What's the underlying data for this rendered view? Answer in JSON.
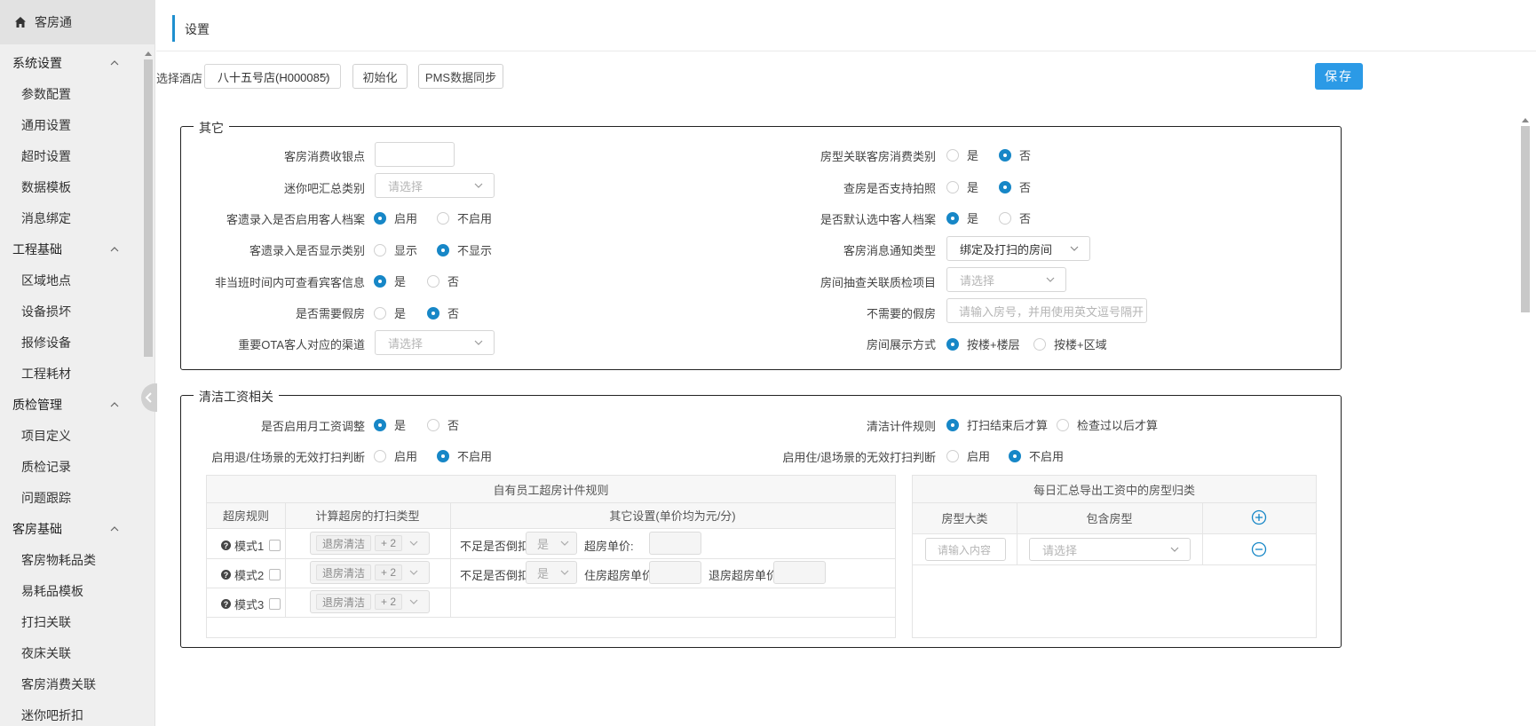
{
  "app": {
    "title": "客房通"
  },
  "sidebar": {
    "groups": [
      {
        "label": "系统设置",
        "items": [
          "参数配置",
          "通用设置",
          "超时设置",
          "数据模板",
          "消息绑定"
        ]
      },
      {
        "label": "工程基础",
        "items": [
          "区域地点",
          "设备损坏",
          "报修设备",
          "工程耗材"
        ]
      },
      {
        "label": "质检管理",
        "items": [
          "项目定义",
          "质检记录",
          "问题跟踪"
        ]
      },
      {
        "label": "客房基础",
        "items": [
          "客房物耗品类",
          "易耗品模板",
          "打扫关联",
          "夜床关联",
          "客房消费关联",
          "迷你吧折扣"
        ]
      }
    ]
  },
  "page": {
    "title": "设置"
  },
  "toolbar": {
    "hotel_label": "选择酒店",
    "hotel_value": "八十五号店(H000085)",
    "init_button": "初始化",
    "pms_button": "PMS数据同步",
    "save_button": "保存"
  },
  "other": {
    "legend": "其它",
    "left": {
      "r1_label": "客房消费收银点",
      "r2_label": "迷你吧汇总类别",
      "r2_placeholder": "请选择",
      "r3_label": "客遗录入是否启用客人档案",
      "r3_opt1": "启用",
      "r3_opt2": "不启用",
      "r3_selected": "启用",
      "r4_label": "客遗录入是否显示类别",
      "r4_opt1": "显示",
      "r4_opt2": "不显示",
      "r4_selected": "不显示",
      "r5_label": "非当班时间内可查看宾客信息",
      "r5_opt1": "是",
      "r5_opt2": "否",
      "r5_selected": "是",
      "r6_label": "是否需要假房",
      "r6_opt1": "是",
      "r6_opt2": "否",
      "r6_selected": "否",
      "r7_label": "重要OTA客人对应的渠道",
      "r7_placeholder": "请选择"
    },
    "right": {
      "r1_label": "房型关联客房消费类别",
      "r1_opt1": "是",
      "r1_opt2": "否",
      "r1_selected": "否",
      "r2_label": "查房是否支持拍照",
      "r2_opt1": "是",
      "r2_opt2": "否",
      "r2_selected": "否",
      "r3_label": "是否默认选中客人档案",
      "r3_opt1": "是",
      "r3_opt2": "否",
      "r3_selected": "是",
      "r4_label": "客房消息通知类型",
      "r4_value": "绑定及打扫的房间",
      "r5_label": "房间抽查关联质检项目",
      "r5_placeholder": "请选择",
      "r6_label": "不需要的假房",
      "r6_placeholder": "请输入房号，并用使用英文逗号隔开",
      "r7_label": "房间展示方式",
      "r7_opt1": "按楼+楼层",
      "r7_opt2": "按楼+区域",
      "r7_selected": "按楼+楼层"
    }
  },
  "cleaning": {
    "legend": "清洁工资相关",
    "l1_label": "是否启用月工资调整",
    "l1_opt1": "是",
    "l1_opt2": "否",
    "l1_selected": "是",
    "l2_label": "启用退/住场景的无效打扫判断",
    "l2_opt1": "启用",
    "l2_opt2": "不启用",
    "l2_selected": "不启用",
    "r1_label": "清洁计件规则",
    "r1_opt1": "打扫结束后才算",
    "r1_opt2": "检查过以后才算",
    "r1_selected": "打扫结束后才算",
    "r2_label": "启用住/退场景的无效打扫判断",
    "r2_opt1": "启用",
    "r2_opt2": "不启用",
    "r2_selected": "不启用",
    "overtime_table": {
      "title": "自有员工超房计件规则",
      "col1": "超房规则",
      "col2": "计算超房的打扫类型",
      "col3": "其它设置(单价均为元/分)",
      "tag": "退房清洁",
      "tag_more": "+ 2",
      "rows": [
        {
          "mode": "模式1",
          "deduct_label": "不足是否倒扣:",
          "deduct_value": "是",
          "price1_label": "超房单价:",
          "price2_label": ""
        },
        {
          "mode": "模式2",
          "deduct_label": "不足是否倒扣:",
          "deduct_value": "是",
          "price1_label": "住房超房单价:",
          "price2_label": "退房超房单价:"
        },
        {
          "mode": "模式3",
          "deduct_label": "",
          "deduct_value": "",
          "price1_label": "",
          "price2_label": ""
        }
      ]
    },
    "roomtype_table": {
      "title": "每日汇总导出工资中的房型归类",
      "col1": "房型大类",
      "col2": "包含房型",
      "input_placeholder": "请输入内容",
      "select_placeholder": "请选择"
    }
  },
  "colors": {
    "accent": "#1e8fcf",
    "primary": "#2b9ae6",
    "radio_on": "#1787c7"
  }
}
